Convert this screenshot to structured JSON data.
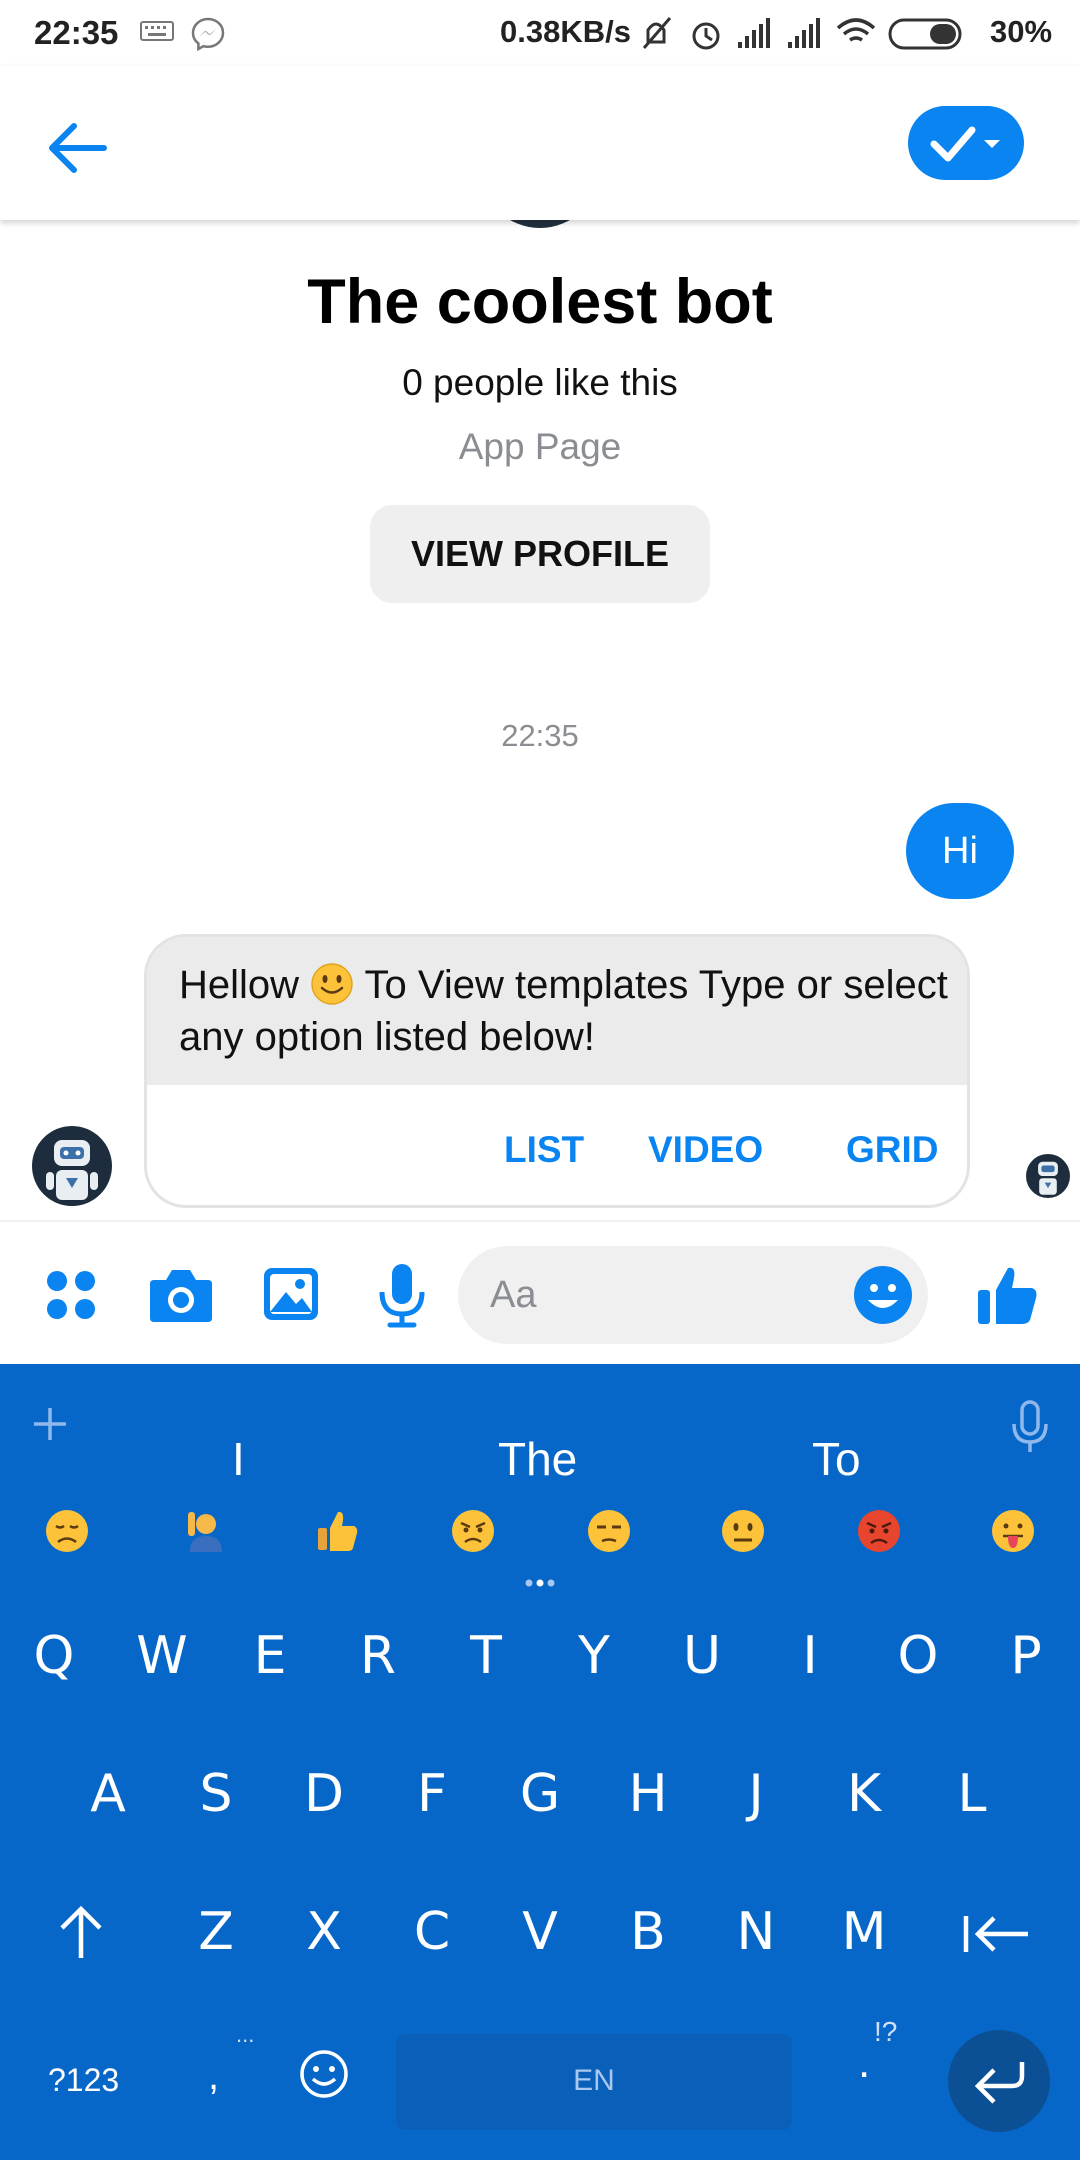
{
  "status_bar": {
    "time": "22:35",
    "speed": "0.38KB/s",
    "battery": "30%"
  },
  "header": {
    "back_icon": "arrow-left-icon",
    "check_icon": "check-dropdown-icon"
  },
  "profile": {
    "name": "The coolest bot",
    "likes": "0 people like this",
    "category": "App Page",
    "view_profile_label": "VIEW PROFILE"
  },
  "conversation": {
    "timestamp": "22:35",
    "outgoing_message": "Hi",
    "bot_message_part1": "Hellow ",
    "bot_message_part2": " To View templates Type or select any option listed below!",
    "quick_replies": [
      "LIST",
      "VIDEO",
      "GRID"
    ]
  },
  "composer": {
    "placeholder": "Aa"
  },
  "keyboard": {
    "suggestions": [
      "I",
      "The",
      "To"
    ],
    "row1": [
      "Q",
      "W",
      "E",
      "R",
      "T",
      "Y",
      "U",
      "I",
      "O",
      "P"
    ],
    "row2": [
      "A",
      "S",
      "D",
      "F",
      "G",
      "H",
      "J",
      "K",
      "L"
    ],
    "row3": [
      "Z",
      "X",
      "C",
      "V",
      "B",
      "N",
      "M"
    ],
    "symbols_key": "?123",
    "comma_key": ",",
    "space_label": "EN",
    "period_key": ".",
    "period_hint": "!?",
    "comma_hint": "..."
  },
  "colors": {
    "accent": "#0a84f0",
    "keyboard_bg": "#0767c9",
    "bubble_gray": "#ebebeb"
  }
}
